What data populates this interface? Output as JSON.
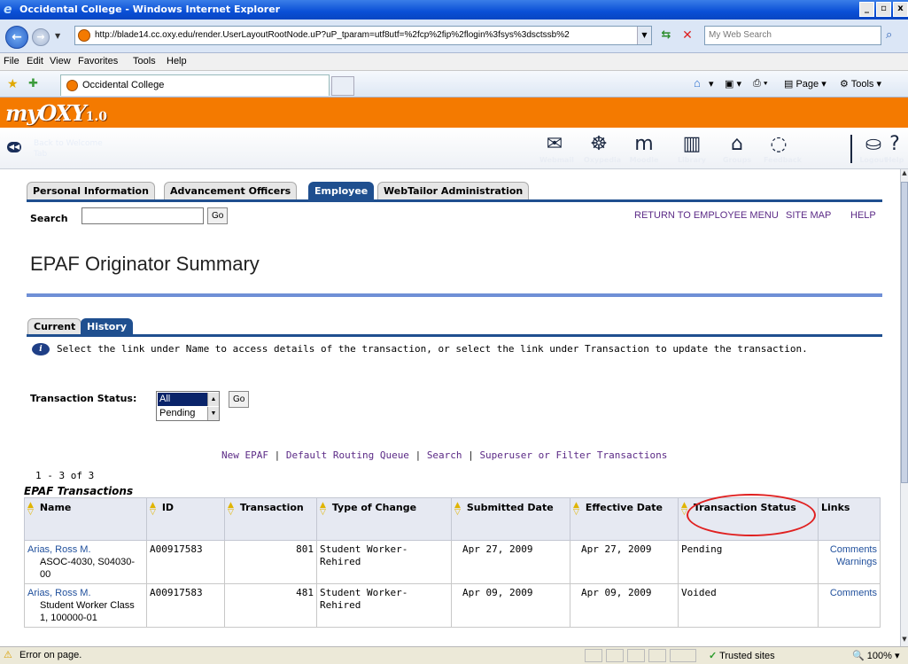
{
  "window": {
    "title": "Occidental College - Windows Internet Explorer"
  },
  "address": {
    "url": "http://blade14.cc.oxy.edu/render.UserLayoutRootNode.uP?uP_tparam=utf8utf=%2fcp%2fip%2flogin%3fsys%3dsctssb%2",
    "search_placeholder": "My Web Search"
  },
  "menu": [
    "File",
    "Edit",
    "View",
    "Favorites",
    "Tools",
    "Help"
  ],
  "browser_tab": {
    "label": "Occidental College"
  },
  "browser_tools": {
    "page": "Page",
    "tools": "Tools"
  },
  "portal": {
    "logo": "myOXY",
    "version": "1.0",
    "back_tab": "Back to Welcome Tab",
    "icons": [
      {
        "label": "Webmail",
        "glyph": "✉"
      },
      {
        "label": "Oxypedia",
        "glyph": "☸"
      },
      {
        "label": "Moodle",
        "glyph": "m"
      },
      {
        "label": "Library",
        "glyph": "▥"
      },
      {
        "label": "Groups",
        "glyph": "⌂"
      },
      {
        "label": "Feedback",
        "glyph": "◌"
      },
      {
        "label": "Logout",
        "glyph": "⛀"
      },
      {
        "label": "Help",
        "glyph": "?"
      }
    ]
  },
  "banner": {
    "tabs": [
      "Personal Information",
      "Advancement Officers",
      "Employee",
      "WebTailor Administration"
    ],
    "active_tab": "Employee",
    "search_label": "Search",
    "go": "Go",
    "top_links": [
      "RETURN TO EMPLOYEE MENU",
      "SITE MAP",
      "HELP"
    ],
    "page_title": "EPAF Originator Summary",
    "sub_tabs": [
      "Current",
      "History"
    ],
    "active_sub_tab": "History",
    "info": "Select the link under Name to access details of the transaction, or select the link under Transaction to update the transaction.",
    "status_label": "Transaction Status:",
    "status_options": [
      "All",
      "Pending"
    ],
    "status_selected": "All",
    "action_links": [
      "New EPAF",
      "Default Routing Queue",
      "Search",
      "Superuser or Filter Transactions"
    ],
    "separator": "|",
    "count": "1 - 3 of 3",
    "caption": "EPAF Transactions",
    "columns": [
      "Name",
      "ID",
      "Transaction",
      "Type of Change",
      "Submitted Date",
      "Effective Date",
      "Transaction Status",
      "Links"
    ],
    "rows": [
      {
        "name": "Arias, Ross M.",
        "position": "ASOC-4030, S04030-00",
        "id": "A00917583",
        "transaction": "801",
        "type": "Student Worker-Rehired",
        "submitted": "Apr 27, 2009",
        "effective": "Apr 27, 2009",
        "status": "Pending",
        "links": [
          "Comments",
          "Warnings"
        ]
      },
      {
        "name": "Arias, Ross M.",
        "position": "Student Worker Class 1, 100000-01",
        "id": "A00917583",
        "transaction": "481",
        "type": "Student Worker-Rehired",
        "submitted": "Apr 09, 2009",
        "effective": "Apr 09, 2009",
        "status": "Voided",
        "links": [
          "Comments"
        ]
      }
    ]
  },
  "status_bar": {
    "message": "Error on page.",
    "zone": "Trusted sites",
    "zoom": "100%"
  }
}
